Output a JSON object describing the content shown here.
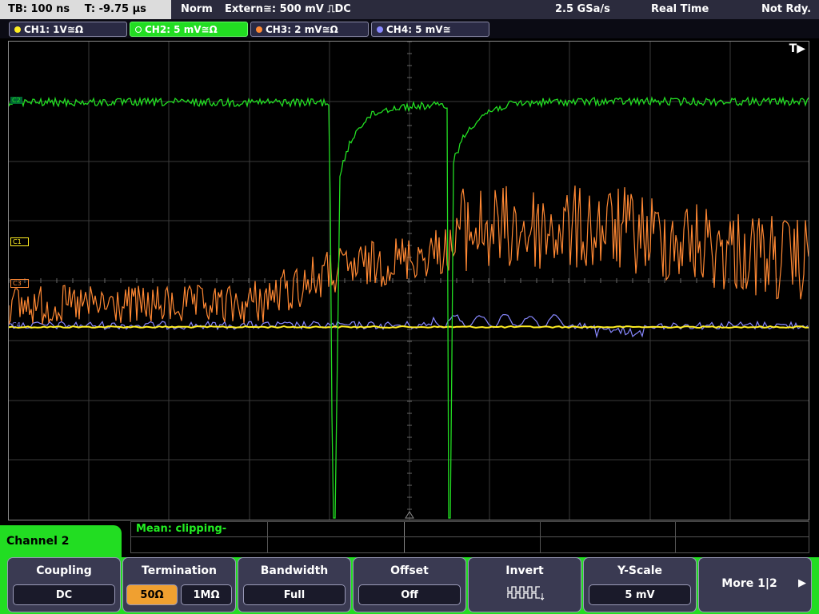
{
  "topbar": {
    "timebase": "TB: 100 ns",
    "trigger_time": "T: -9.75 µs",
    "trigger_mode": "Norm",
    "trigger_source": "Extern≅: 500 mV ⎍DC",
    "sample_rate": "2.5 GSa/s",
    "acq_mode": "Real Time",
    "status": "Not Rdy."
  },
  "channels": [
    {
      "label": "CH1: 1V≅Ω",
      "color": "#ffee22"
    },
    {
      "label": "CH2: 5 mV≅Ω",
      "color": "#22dd22"
    },
    {
      "label": "CH3: 2 mV≅Ω",
      "color": "#ff8833"
    },
    {
      "label": "CH4: 5 mV≅",
      "color": "#8888ff"
    }
  ],
  "grid": {
    "trigger_marker": "T▶",
    "ch_markers": {
      "c1": "C1",
      "c2": "C2",
      "c3": "C3",
      "c4": "C4"
    }
  },
  "measurement": {
    "mean_label": "Mean: clipping-"
  },
  "menu": {
    "channel_label": "Channel 2",
    "coupling": {
      "title": "Coupling",
      "value": "DC"
    },
    "termination": {
      "title": "Termination",
      "opt1": "50Ω",
      "opt2": "1MΩ"
    },
    "bandwidth": {
      "title": "Bandwidth",
      "value": "Full"
    },
    "offset": {
      "title": "Offset",
      "value": "Off"
    },
    "invert": {
      "title": "Invert"
    },
    "yscale": {
      "title": "Y-Scale",
      "value": "5 mV"
    },
    "more": {
      "label": "More 1|2"
    }
  }
}
